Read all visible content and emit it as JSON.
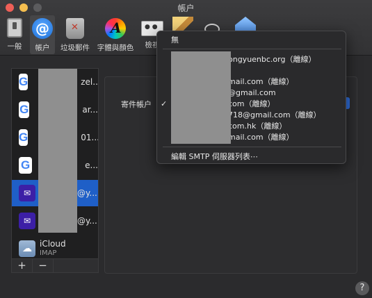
{
  "window": {
    "title": "帳户"
  },
  "toolbar": {
    "items": [
      {
        "label": "一般",
        "icon": "general-switch-icon"
      },
      {
        "label": "帳户",
        "icon": "at-sign-icon"
      },
      {
        "label": "垃圾郵件",
        "icon": "junk-trash-icon"
      },
      {
        "label": "字體與顏色",
        "icon": "fonts-colors-icon"
      },
      {
        "label": "檢視",
        "icon": "viewing-icon"
      }
    ]
  },
  "accounts": [
    {
      "kind": "google",
      "visible_text": "zel..."
    },
    {
      "kind": "google",
      "visible_text": "ar..."
    },
    {
      "kind": "google",
      "visible_text": "01..."
    },
    {
      "kind": "google",
      "visible_text": "e..."
    },
    {
      "kind": "mail",
      "visible_text": "@y...",
      "selected": true
    },
    {
      "kind": "mail",
      "visible_text": "@y..."
    },
    {
      "kind": "icloud",
      "name": "iCloud",
      "type": "IMAP"
    }
  ],
  "list_footer": {
    "add": "+",
    "remove": "−"
  },
  "detail": {
    "sender_label": "寄件帳户"
  },
  "smtp_menu": {
    "none": "無",
    "servers": [
      "ongyuenbc.org（離線）",
      "mail.com（離線）",
      "@gmail.com",
      "com（離線）",
      "718@gmail.com（離線）",
      "com.hk（離線）",
      "mail.com（離線）"
    ],
    "edit": "編輯 SMTP 伺服器列表⋯"
  },
  "help": "?",
  "colors": {
    "accent": "#1f5fc7",
    "background": "#2b2b2d"
  }
}
